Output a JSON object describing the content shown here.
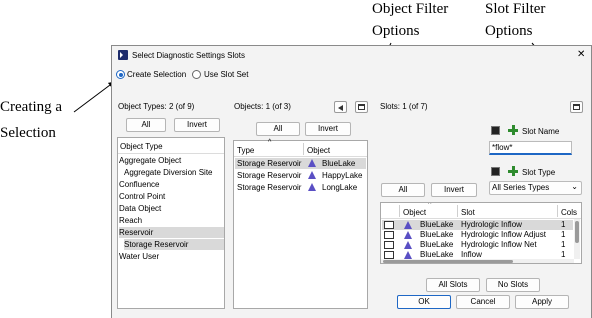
{
  "annotations": {
    "object_filter": [
      "Object Filter",
      "Options"
    ],
    "slot_filter": [
      "Slot Filter",
      "Options"
    ],
    "creating": [
      "Creating a",
      "Selection"
    ]
  },
  "window": {
    "title": "Select Diagnostic Settings Slots",
    "close": "✕"
  },
  "mode": {
    "create_label": "Create Selection",
    "use_label": "Use Slot Set",
    "selected": "create"
  },
  "object_types": {
    "header": "Object Types: 2 (of 9)",
    "all": "All",
    "invert": "Invert",
    "column": "Object Type",
    "items": [
      {
        "label": "Aggregate Object",
        "indent": false,
        "selected": false
      },
      {
        "label": "Aggregate Diversion Site",
        "indent": true,
        "selected": false
      },
      {
        "label": "Confluence",
        "indent": false,
        "selected": false
      },
      {
        "label": "Control Point",
        "indent": false,
        "selected": false
      },
      {
        "label": "Data Object",
        "indent": false,
        "selected": false
      },
      {
        "label": "Reach",
        "indent": false,
        "selected": false
      },
      {
        "label": "Reservoir",
        "indent": false,
        "selected": true
      },
      {
        "label": "Storage Reservoir",
        "indent": true,
        "selected": true
      },
      {
        "label": "Water User",
        "indent": false,
        "selected": false
      }
    ]
  },
  "objects": {
    "header": "Objects: 1 (of 3)",
    "all": "All",
    "invert": "Invert",
    "col_type": "Type",
    "col_object": "Object",
    "rows": [
      {
        "type": "Storage Reservoir",
        "object": "BlueLake",
        "selected": true
      },
      {
        "type": "Storage Reservoir",
        "object": "HappyLake",
        "selected": false
      },
      {
        "type": "Storage Reservoir",
        "object": "LongLake",
        "selected": false
      }
    ]
  },
  "slots": {
    "header": "Slots: 1 (of 7)",
    "slot_name_label": "Slot Name",
    "slot_name_value": "*flow*",
    "slot_type_label": "Slot Type",
    "slot_type_value": "All Series Types",
    "all": "All",
    "invert": "Invert",
    "col_object": "Object",
    "col_slot": "Slot",
    "col_cols": "Cols",
    "rows": [
      {
        "object": "BlueLake",
        "slot": "Hydrologic Inflow",
        "cols": "1",
        "selected": true
      },
      {
        "object": "BlueLake",
        "slot": "Hydrologic Inflow Adjust",
        "cols": "1",
        "selected": false
      },
      {
        "object": "BlueLake",
        "slot": "Hydrologic Inflow Net",
        "cols": "1",
        "selected": false
      },
      {
        "object": "BlueLake",
        "slot": "Inflow",
        "cols": "1",
        "selected": false
      }
    ],
    "all_slots": "All Slots",
    "no_slots": "No Slots"
  },
  "footer": {
    "ok": "OK",
    "cancel": "Cancel",
    "apply": "Apply"
  },
  "colors": {
    "accent": "#1e67c5",
    "selection": "#d9d9d9",
    "icon_triangle": "#5a4fc4",
    "plus": "#2e8b2e"
  }
}
